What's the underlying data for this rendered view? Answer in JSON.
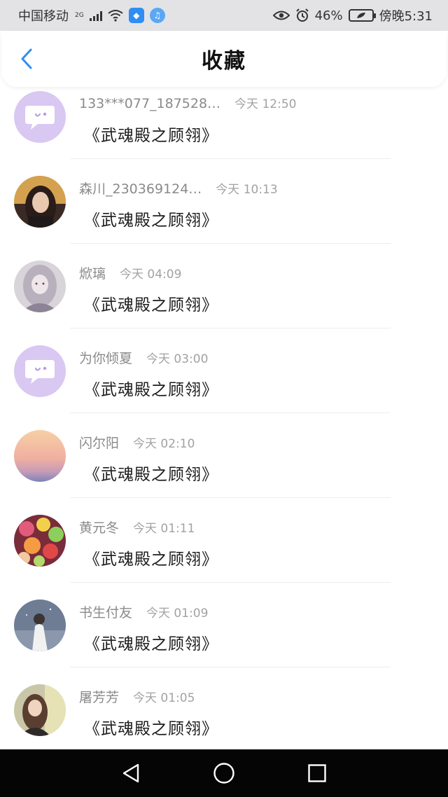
{
  "status_bar": {
    "carrier": "中国移动",
    "network": "2G",
    "battery": "46%",
    "time": "傍晚5:31"
  },
  "header": {
    "title": "收藏"
  },
  "favorites": [
    {
      "name": "133***077_187528…",
      "time": "今天 12:50",
      "content": "《武魂殿之顾翎》",
      "avatar": "chat-bubble-icon"
    },
    {
      "name": "森川_230369124…",
      "time": "今天 10:13",
      "content": "《武魂殿之顾翎》",
      "avatar": "photo-avatar"
    },
    {
      "name": "焮璃",
      "time": "今天 04:09",
      "content": "《武魂殿之顾翎》",
      "avatar": "photo-avatar"
    },
    {
      "name": "为你倾夏",
      "time": "今天 03:00",
      "content": "《武魂殿之顾翎》",
      "avatar": "chat-bubble-icon"
    },
    {
      "name": "闪尔阳",
      "time": "今天 02:10",
      "content": "《武魂殿之顾翎》",
      "avatar": "photo-avatar"
    },
    {
      "name": "黄元冬",
      "time": "今天 01:11",
      "content": "《武魂殿之顾翎》",
      "avatar": "photo-avatar"
    },
    {
      "name": "书生付友",
      "time": "今天 01:09",
      "content": "《武魂殿之顾翎》",
      "avatar": "photo-avatar"
    },
    {
      "name": "屠芳芳",
      "time": "今天 01:05",
      "content": "《武魂殿之顾翎》",
      "avatar": "photo-avatar"
    }
  ],
  "colors": {
    "accent": "#2f8ef4",
    "chat_avatar_bg": "#d9c8f2",
    "system_nav_bg": "#050505"
  }
}
